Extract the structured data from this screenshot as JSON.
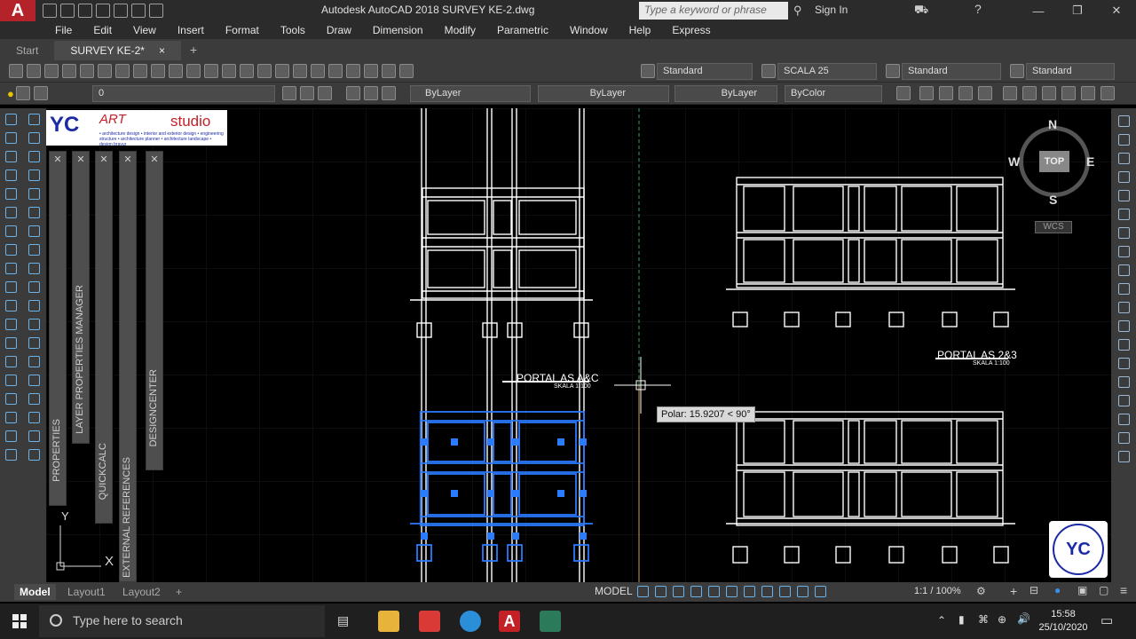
{
  "titlebar": {
    "app_logo": "A",
    "title": "Autodesk AutoCAD 2018    SURVEY KE-2.dwg",
    "search_placeholder": "Type a keyword or phrase",
    "sign_in": "Sign In"
  },
  "menu": [
    "File",
    "Edit",
    "View",
    "Insert",
    "Format",
    "Tools",
    "Draw",
    "Dimension",
    "Modify",
    "Parametric",
    "Window",
    "Help",
    "Express"
  ],
  "tabs": {
    "start": "Start",
    "doc": "SURVEY KE-2*",
    "close": "×",
    "add": "+"
  },
  "toolbar1": {
    "text_style": "Standard",
    "dim_style": "SCALA 25",
    "table_style": "Standard",
    "mleader_style": "Standard"
  },
  "toolbar2": {
    "layer": "0",
    "color": "ByLayer",
    "linetype": "ByLayer",
    "lineweight": "ByLayer",
    "plotstyle": "ByColor"
  },
  "palettes": {
    "properties": "PROPERTIES",
    "layer_manager": "LAYER PROPERTIES MANAGER",
    "quickcalc": "QUICKCALC",
    "xref": "EXTERNAL REFERENCES",
    "designcenter": "DESIGNCENTER"
  },
  "logo": {
    "initials": "YC",
    "art": "ART",
    "studio": "studio",
    "tagline": "• architecture design  • interior and exterior design  • engineering structure  • architecture planner  • architecture landscape  • design bravur"
  },
  "viewcube": {
    "north": "N",
    "south": "S",
    "west": "W",
    "east": "E",
    "face": "TOP",
    "wcs": "WCS"
  },
  "drawing": {
    "portal_left": "PORTAL AS A&C",
    "portal_left_scale": "SKALA 1:100",
    "portal_right": "PORTAL AS 2&3",
    "portal_right_scale": "SKALA 1:100",
    "polar_tooltip": "Polar: 15.9207 < 90°",
    "ucs_x": "X",
    "ucs_y": "Y"
  },
  "layout_tabs": {
    "model": "Model",
    "layout1": "Layout1",
    "layout2": "Layout2",
    "add": "+"
  },
  "status": {
    "mode": "MODEL",
    "scale": "1:1 / 100%"
  },
  "taskbar": {
    "search_placeholder": "Type here to search",
    "time": "15:58",
    "date": "25/10/2020"
  },
  "colors": {
    "accent": "#b5232a",
    "canvas": "#000000",
    "selection": "#1e6cff",
    "ui_dark": "#3b3b3b"
  }
}
